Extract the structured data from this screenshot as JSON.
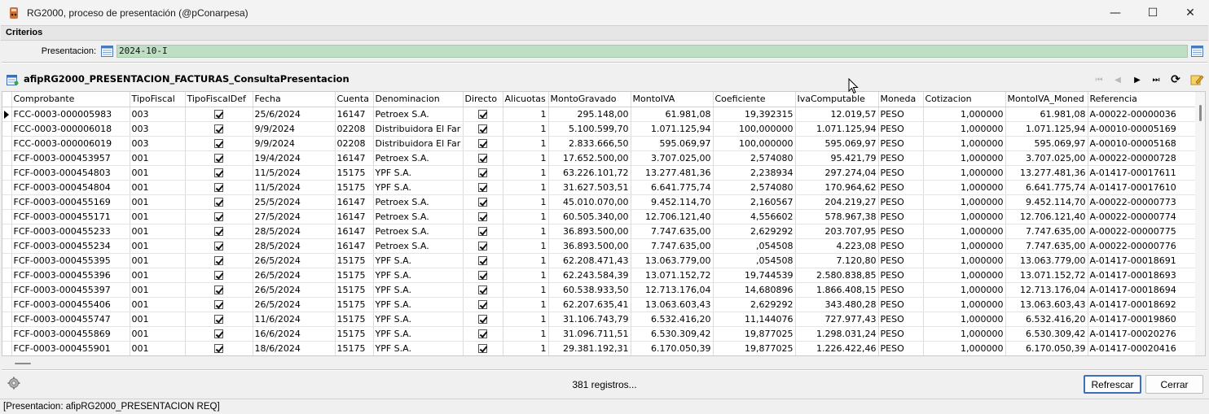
{
  "window": {
    "title": "RG2000, proceso de presentación (@pConarpesa)",
    "minimize": "—",
    "maximize": "☐",
    "close": "✕"
  },
  "criteria": {
    "section_label": "Criterios",
    "presentacion_label": "Presentacion:",
    "presentacion_value": "2024-10-I"
  },
  "panel": {
    "title": "afipRG2000_PRESENTACION_FACTURAS_ConsultaPresentacion",
    "nav": {
      "first": "⏮",
      "prev": "◀",
      "next": "▶",
      "last": "⏭",
      "refresh": "⟳"
    }
  },
  "table": {
    "columns": [
      "Comprobante",
      "TipoFiscal",
      "TipoFiscalDef",
      "Fecha",
      "Cuenta",
      "Denominacion",
      "Directo",
      "Alicuotas",
      "MontoGravado",
      "MontoIVA",
      "Coeficiente",
      "IvaComputable",
      "Moneda",
      "Cotizacion",
      "MontoIVA_Moned",
      "Referencia"
    ],
    "rows": [
      [
        "FCC-0003-000005983",
        "003",
        "",
        "25/6/2024",
        "16147",
        "Petroex S.A.",
        "",
        "1",
        "295.148,00",
        "61.981,08",
        "19,392315",
        "12.019,57",
        "PESO",
        "1,000000",
        "61.981,08",
        "A-00022-00000036"
      ],
      [
        "FCC-0003-000006018",
        "003",
        "",
        "9/9/2024",
        "02208",
        "Distribuidora El Far",
        "",
        "1",
        "5.100.599,70",
        "1.071.125,94",
        "100,000000",
        "1.071.125,94",
        "PESO",
        "1,000000",
        "1.071.125,94",
        "A-00010-00005169"
      ],
      [
        "FCC-0003-000006019",
        "003",
        "",
        "9/9/2024",
        "02208",
        "Distribuidora El Far",
        "",
        "1",
        "2.833.666,50",
        "595.069,97",
        "100,000000",
        "595.069,97",
        "PESO",
        "1,000000",
        "595.069,97",
        "A-00010-00005168"
      ],
      [
        "FCF-0003-000453957",
        "001",
        "",
        "19/4/2024",
        "16147",
        "Petroex S.A.",
        "",
        "1",
        "17.652.500,00",
        "3.707.025,00",
        "2,574080",
        "95.421,79",
        "PESO",
        "1,000000",
        "3.707.025,00",
        "A-00022-00000728"
      ],
      [
        "FCF-0003-000454803",
        "001",
        "",
        "11/5/2024",
        "15175",
        "YPF S.A.",
        "",
        "1",
        "63.226.101,72",
        "13.277.481,36",
        "2,238934",
        "297.274,04",
        "PESO",
        "1,000000",
        "13.277.481,36",
        "A-01417-00017611"
      ],
      [
        "FCF-0003-000454804",
        "001",
        "",
        "11/5/2024",
        "15175",
        "YPF S.A.",
        "",
        "1",
        "31.627.503,51",
        "6.641.775,74",
        "2,574080",
        "170.964,62",
        "PESO",
        "1,000000",
        "6.641.775,74",
        "A-01417-00017610"
      ],
      [
        "FCF-0003-000455169",
        "001",
        "",
        "25/5/2024",
        "16147",
        "Petroex S.A.",
        "",
        "1",
        "45.010.070,00",
        "9.452.114,70",
        "2,160567",
        "204.219,27",
        "PESO",
        "1,000000",
        "9.452.114,70",
        "A-00022-00000773"
      ],
      [
        "FCF-0003-000455171",
        "001",
        "",
        "27/5/2024",
        "16147",
        "Petroex S.A.",
        "",
        "1",
        "60.505.340,00",
        "12.706.121,40",
        "4,556602",
        "578.967,38",
        "PESO",
        "1,000000",
        "12.706.121,40",
        "A-00022-00000774"
      ],
      [
        "FCF-0003-000455233",
        "001",
        "",
        "28/5/2024",
        "16147",
        "Petroex S.A.",
        "",
        "1",
        "36.893.500,00",
        "7.747.635,00",
        "2,629292",
        "203.707,95",
        "PESO",
        "1,000000",
        "7.747.635,00",
        "A-00022-00000775"
      ],
      [
        "FCF-0003-000455234",
        "001",
        "",
        "28/5/2024",
        "16147",
        "Petroex S.A.",
        "",
        "1",
        "36.893.500,00",
        "7.747.635,00",
        ",054508",
        "4.223,08",
        "PESO",
        "1,000000",
        "7.747.635,00",
        "A-00022-00000776"
      ],
      [
        "FCF-0003-000455395",
        "001",
        "",
        "26/5/2024",
        "15175",
        "YPF S.A.",
        "",
        "1",
        "62.208.471,43",
        "13.063.779,00",
        ",054508",
        "7.120,80",
        "PESO",
        "1,000000",
        "13.063.779,00",
        "A-01417-00018691"
      ],
      [
        "FCF-0003-000455396",
        "001",
        "",
        "26/5/2024",
        "15175",
        "YPF S.A.",
        "",
        "1",
        "62.243.584,39",
        "13.071.152,72",
        "19,744539",
        "2.580.838,85",
        "PESO",
        "1,000000",
        "13.071.152,72",
        "A-01417-00018693"
      ],
      [
        "FCF-0003-000455397",
        "001",
        "",
        "26/5/2024",
        "15175",
        "YPF S.A.",
        "",
        "1",
        "60.538.933,50",
        "12.713.176,04",
        "14,680896",
        "1.866.408,15",
        "PESO",
        "1,000000",
        "12.713.176,04",
        "A-01417-00018694"
      ],
      [
        "FCF-0003-000455406",
        "001",
        "",
        "26/5/2024",
        "15175",
        "YPF S.A.",
        "",
        "1",
        "62.207.635,41",
        "13.063.603,43",
        "2,629292",
        "343.480,28",
        "PESO",
        "1,000000",
        "13.063.603,43",
        "A-01417-00018692"
      ],
      [
        "FCF-0003-000455747",
        "001",
        "",
        "11/6/2024",
        "15175",
        "YPF S.A.",
        "",
        "1",
        "31.106.743,79",
        "6.532.416,20",
        "11,144076",
        "727.977,43",
        "PESO",
        "1,000000",
        "6.532.416,20",
        "A-01417-00019860"
      ],
      [
        "FCF-0003-000455869",
        "001",
        "",
        "16/6/2024",
        "15175",
        "YPF S.A.",
        "",
        "1",
        "31.096.711,51",
        "6.530.309,42",
        "19,877025",
        "1.298.031,24",
        "PESO",
        "1,000000",
        "6.530.309,42",
        "A-01417-00020276"
      ],
      [
        "FCF-0003-000455901",
        "001",
        "",
        "18/6/2024",
        "15175",
        "YPF S.A.",
        "",
        "1",
        "29.381.192,31",
        "6.170.050,39",
        "19,877025",
        "1.226.422,46",
        "PESO",
        "1,000000",
        "6.170.050,39",
        "A-01417-00020416"
      ]
    ]
  },
  "footer": {
    "count": "381 registros...",
    "refresh_button": "Refrescar",
    "close_button": "Cerrar"
  },
  "statusbar": {
    "text": "[Presentacion: afipRG2000_PRESENTACION REQ]"
  },
  "colors": {
    "input_bg": "#bfdfc5",
    "primary_border": "#3c6fb8"
  }
}
